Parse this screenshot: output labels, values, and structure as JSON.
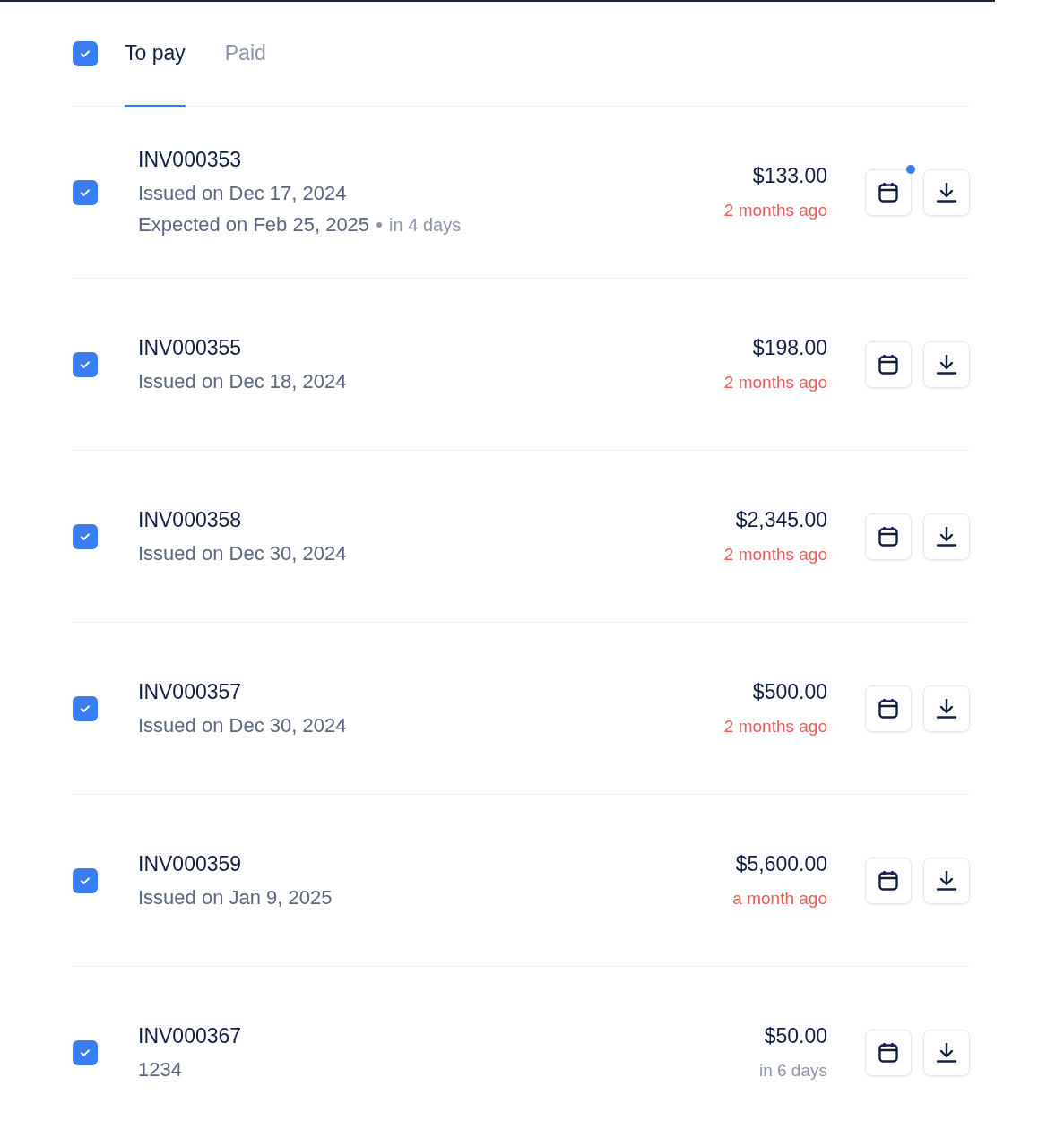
{
  "header": {
    "select_all": {
      "checked": true
    },
    "tabs": [
      {
        "label": "To pay",
        "selected": true
      },
      {
        "label": "Paid",
        "selected": false
      }
    ]
  },
  "invoices": [
    {
      "number": "INV000353",
      "checked": true,
      "details": [
        "Issued on Dec 17, 2024"
      ],
      "expected": {
        "text": "Expected on Feb 25, 2025",
        "note": "in 4 days"
      },
      "amount": "$133.00",
      "due": "2 months ago",
      "overdue": true,
      "calendar_notified": true
    },
    {
      "number": "INV000355",
      "checked": true,
      "details": [
        "Issued on Dec 18, 2024"
      ],
      "amount": "$198.00",
      "due": "2 months ago",
      "overdue": true,
      "calendar_notified": false
    },
    {
      "number": "INV000358",
      "checked": true,
      "details": [
        "Issued on Dec 30, 2024"
      ],
      "amount": "$2,345.00",
      "due": "2 months ago",
      "overdue": true,
      "calendar_notified": false
    },
    {
      "number": "INV000357",
      "checked": true,
      "details": [
        "Issued on Dec 30, 2024"
      ],
      "amount": "$500.00",
      "due": "2 months ago",
      "overdue": true,
      "calendar_notified": false
    },
    {
      "number": "INV000359",
      "checked": true,
      "details": [
        "Issued on Jan 9, 2025"
      ],
      "amount": "$5,600.00",
      "due": "a month ago",
      "overdue": true,
      "calendar_notified": false
    },
    {
      "number": "INV000367",
      "checked": true,
      "details": [
        "1234"
      ],
      "amount": "$50.00",
      "due": "in 6 days",
      "overdue": false,
      "calendar_notified": false
    }
  ]
}
